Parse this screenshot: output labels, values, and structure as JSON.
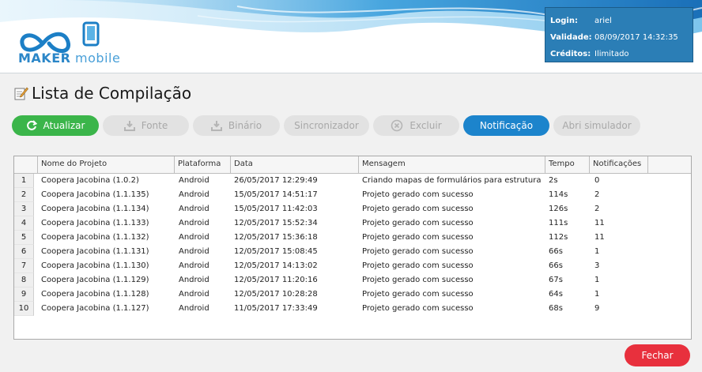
{
  "header": {
    "logo_bold": "MAKER",
    "logo_light": "mobile",
    "info": [
      {
        "label": "Login:",
        "value": "ariel"
      },
      {
        "label": "Validade:",
        "value": "08/09/2017 14:32:35"
      },
      {
        "label": "Créditos:",
        "value": "Ilimitado"
      }
    ]
  },
  "page": {
    "title": "Lista de Compilação"
  },
  "toolbar": {
    "atualizar": "Atualizar",
    "fonte": "Fonte",
    "binario": "Binário",
    "sincronizador": "Sincronizador",
    "excluir": "Excluir",
    "notificacao": "Notificação",
    "simulador": "Abri simulador"
  },
  "table": {
    "columns": [
      "Nome do Projeto",
      "Plataforma",
      "Data",
      "Mensagem",
      "Tempo",
      "Notificações"
    ],
    "rows": [
      {
        "n": "1",
        "nome": "Coopera Jacobina (1.0.2)",
        "plataforma": "Android",
        "data": "26/05/2017 12:29:49",
        "mensagem": "Criando mapas de formulários para estrutura and",
        "tempo": "2s",
        "notificacoes": "0"
      },
      {
        "n": "2",
        "nome": "Coopera Jacobina (1.1.135)",
        "plataforma": "Android",
        "data": "15/05/2017 14:51:17",
        "mensagem": "Projeto gerado com sucesso",
        "tempo": "114s",
        "notificacoes": "2"
      },
      {
        "n": "3",
        "nome": "Coopera Jacobina (1.1.134)",
        "plataforma": "Android",
        "data": "15/05/2017 11:42:03",
        "mensagem": "Projeto gerado com sucesso",
        "tempo": "126s",
        "notificacoes": "2"
      },
      {
        "n": "4",
        "nome": "Coopera Jacobina (1.1.133)",
        "plataforma": "Android",
        "data": "12/05/2017 15:52:34",
        "mensagem": "Projeto gerado com sucesso",
        "tempo": "111s",
        "notificacoes": "11"
      },
      {
        "n": "5",
        "nome": "Coopera Jacobina (1.1.132)",
        "plataforma": "Android",
        "data": "12/05/2017 15:36:18",
        "mensagem": "Projeto gerado com sucesso",
        "tempo": "112s",
        "notificacoes": "11"
      },
      {
        "n": "6",
        "nome": "Coopera Jacobina (1.1.131)",
        "plataforma": "Android",
        "data": "12/05/2017 15:08:45",
        "mensagem": "Projeto gerado com sucesso",
        "tempo": "66s",
        "notificacoes": "1"
      },
      {
        "n": "7",
        "nome": "Coopera Jacobina (1.1.130)",
        "plataforma": "Android",
        "data": "12/05/2017 14:13:02",
        "mensagem": "Projeto gerado com sucesso",
        "tempo": "66s",
        "notificacoes": "3"
      },
      {
        "n": "8",
        "nome": "Coopera Jacobina (1.1.129)",
        "plataforma": "Android",
        "data": "12/05/2017 11:20:16",
        "mensagem": "Projeto gerado com sucesso",
        "tempo": "67s",
        "notificacoes": "1"
      },
      {
        "n": "9",
        "nome": "Coopera Jacobina (1.1.128)",
        "plataforma": "Android",
        "data": "12/05/2017 10:28:28",
        "mensagem": "Projeto gerado com sucesso",
        "tempo": "64s",
        "notificacoes": "1"
      },
      {
        "n": "10",
        "nome": "Coopera Jacobina (1.1.127)",
        "plataforma": "Android",
        "data": "11/05/2017 17:33:49",
        "mensagem": "Projeto gerado com sucesso",
        "tempo": "68s",
        "notificacoes": "9"
      }
    ]
  },
  "footer": {
    "fechar": "Fechar"
  },
  "colors": {
    "accent_blue": "#1c84cc",
    "green": "#3bb54a",
    "red": "#e8303d",
    "info_bg": "#2b7eb6"
  }
}
